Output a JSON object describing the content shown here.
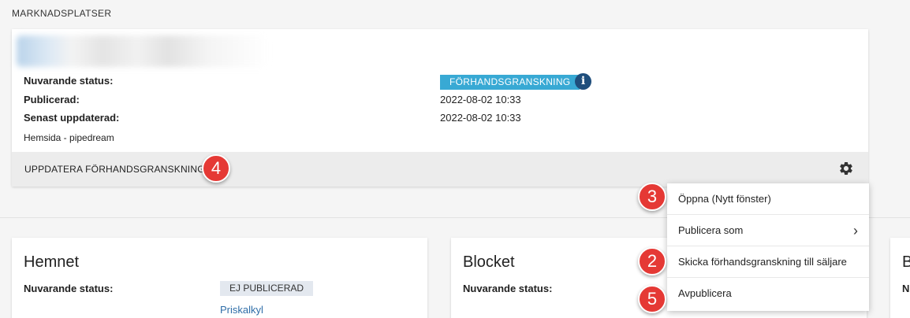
{
  "page": {
    "section_title": "MARKNADSPLATSER"
  },
  "main_card": {
    "status_label": "Nuvarande status:",
    "status_value": "FÖRHANDSGRANSKNING",
    "published_label": "Publicerad:",
    "published_value": "2022-08-02 10:33",
    "updated_label": "Senast uppdaterad:",
    "updated_value": "2022-08-02 10:33",
    "site_name": "Hemsida - pipedream",
    "update_preview_label": "UPPDATERA FÖRHANDSGRANSKNING",
    "info_icon": "i",
    "gear_icon": "gear-icon"
  },
  "dropdown": {
    "items": [
      {
        "label": "Öppna  (Nytt fönster)"
      },
      {
        "label": "Publicera som",
        "chevron": "›"
      },
      {
        "label": "Skicka förhandsgranskning till säljare"
      },
      {
        "label": "Avpublicera"
      }
    ]
  },
  "markers": {
    "m4": "4",
    "m3": "3",
    "m2": "2",
    "m5": "5"
  },
  "marketplaces": [
    {
      "title": "Hemnet",
      "status_label": "Nuvarande status:",
      "status_value": "EJ PUBLICERAD",
      "link": "Priskalkyl"
    },
    {
      "title": "Blocket",
      "status_label": "Nuvarande status:"
    },
    {
      "title": "B",
      "status_label": "N"
    }
  ],
  "colors": {
    "status_pill": "#38a9d4",
    "info_icon": "#1f4e7c",
    "marker": "#e53935",
    "link": "#2f6ea8"
  }
}
